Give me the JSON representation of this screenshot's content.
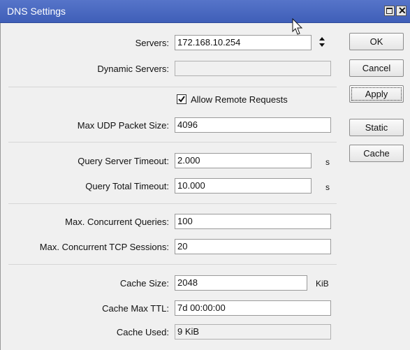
{
  "window": {
    "title": "DNS Settings"
  },
  "fields": {
    "servers": {
      "label": "Servers:",
      "value": "172.168.10.254"
    },
    "dynamic_servers": {
      "label": "Dynamic Servers:",
      "value": ""
    },
    "allow_remote_requests": {
      "label": "Allow Remote Requests",
      "checked": true
    },
    "max_udp_packet_size": {
      "label": "Max UDP Packet Size:",
      "value": "4096"
    },
    "query_server_timeout": {
      "label": "Query Server Timeout:",
      "value": "2.000",
      "unit": "s"
    },
    "query_total_timeout": {
      "label": "Query Total Timeout:",
      "value": "10.000",
      "unit": "s"
    },
    "max_concurrent_queries": {
      "label": "Max. Concurrent Queries:",
      "value": "100"
    },
    "max_concurrent_tcp_sessions": {
      "label": "Max. Concurrent TCP Sessions:",
      "value": "20"
    },
    "cache_size": {
      "label": "Cache Size:",
      "value": "2048",
      "unit": "KiB"
    },
    "cache_max_ttl": {
      "label": "Cache Max TTL:",
      "value": "7d 00:00:00"
    },
    "cache_used": {
      "label": "Cache Used:",
      "value": "9 KiB"
    }
  },
  "buttons": {
    "ok": "OK",
    "cancel": "Cancel",
    "apply": "Apply",
    "static": "Static",
    "cache": "Cache"
  }
}
